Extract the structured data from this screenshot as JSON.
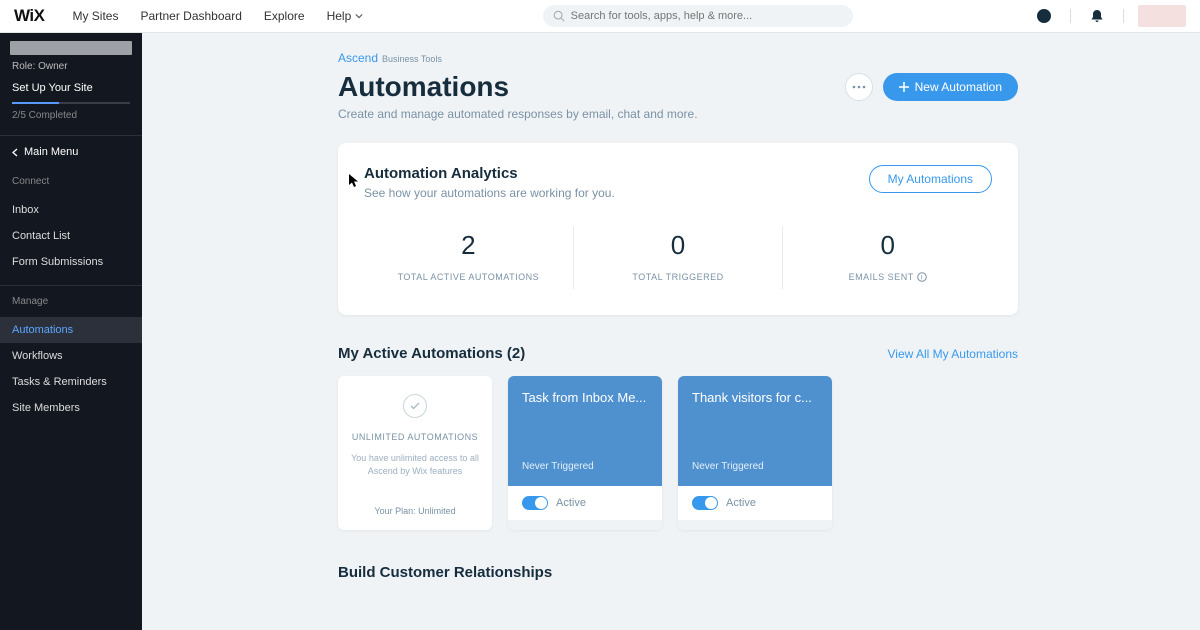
{
  "topbar": {
    "logo": "WiX",
    "nav": [
      "My Sites",
      "Partner Dashboard",
      "Explore",
      "Help"
    ],
    "search_placeholder": "Search for tools, apps, help & more..."
  },
  "sidebar": {
    "role": "Role: Owner",
    "setup": "Set Up Your Site",
    "progress_text": "2/5 Completed",
    "back_label": "Main Menu",
    "section_connect": "Connect",
    "connect_items": [
      "Inbox",
      "Contact List",
      "Form Submissions"
    ],
    "section_manage": "Manage",
    "manage_items": [
      "Automations",
      "Workflows",
      "Tasks & Reminders",
      "Site Members"
    ],
    "active_item": "Automations"
  },
  "header": {
    "ascend": "Ascend",
    "ascend_sub": "Business Tools",
    "title": "Automations",
    "subtitle": "Create and manage automated responses by email, chat and more.",
    "new_btn": "New Automation"
  },
  "analytics": {
    "title": "Automation Analytics",
    "sub": "See how your automations are working for you.",
    "my_btn": "My Automations",
    "stats": [
      {
        "value": "2",
        "label": "TOTAL ACTIVE AUTOMATIONS"
      },
      {
        "value": "0",
        "label": "TOTAL TRIGGERED"
      },
      {
        "value": "0",
        "label": "EMAILS SENT",
        "info": true
      }
    ]
  },
  "active_section": {
    "title": "My Active Automations (2)",
    "view_all": "View All My Automations",
    "plan_card": {
      "title": "UNLIMITED AUTOMATIONS",
      "desc": "You have unlimited access to all Ascend by Wix features",
      "footer": "Your Plan: Unlimited"
    },
    "automations": [
      {
        "title": "Task from Inbox Me...",
        "trigger": "Never Triggered",
        "status": "Active"
      },
      {
        "title": "Thank visitors for c...",
        "trigger": "Never Triggered",
        "status": "Active"
      }
    ]
  },
  "bottom_section": {
    "title": "Build Customer Relationships"
  }
}
